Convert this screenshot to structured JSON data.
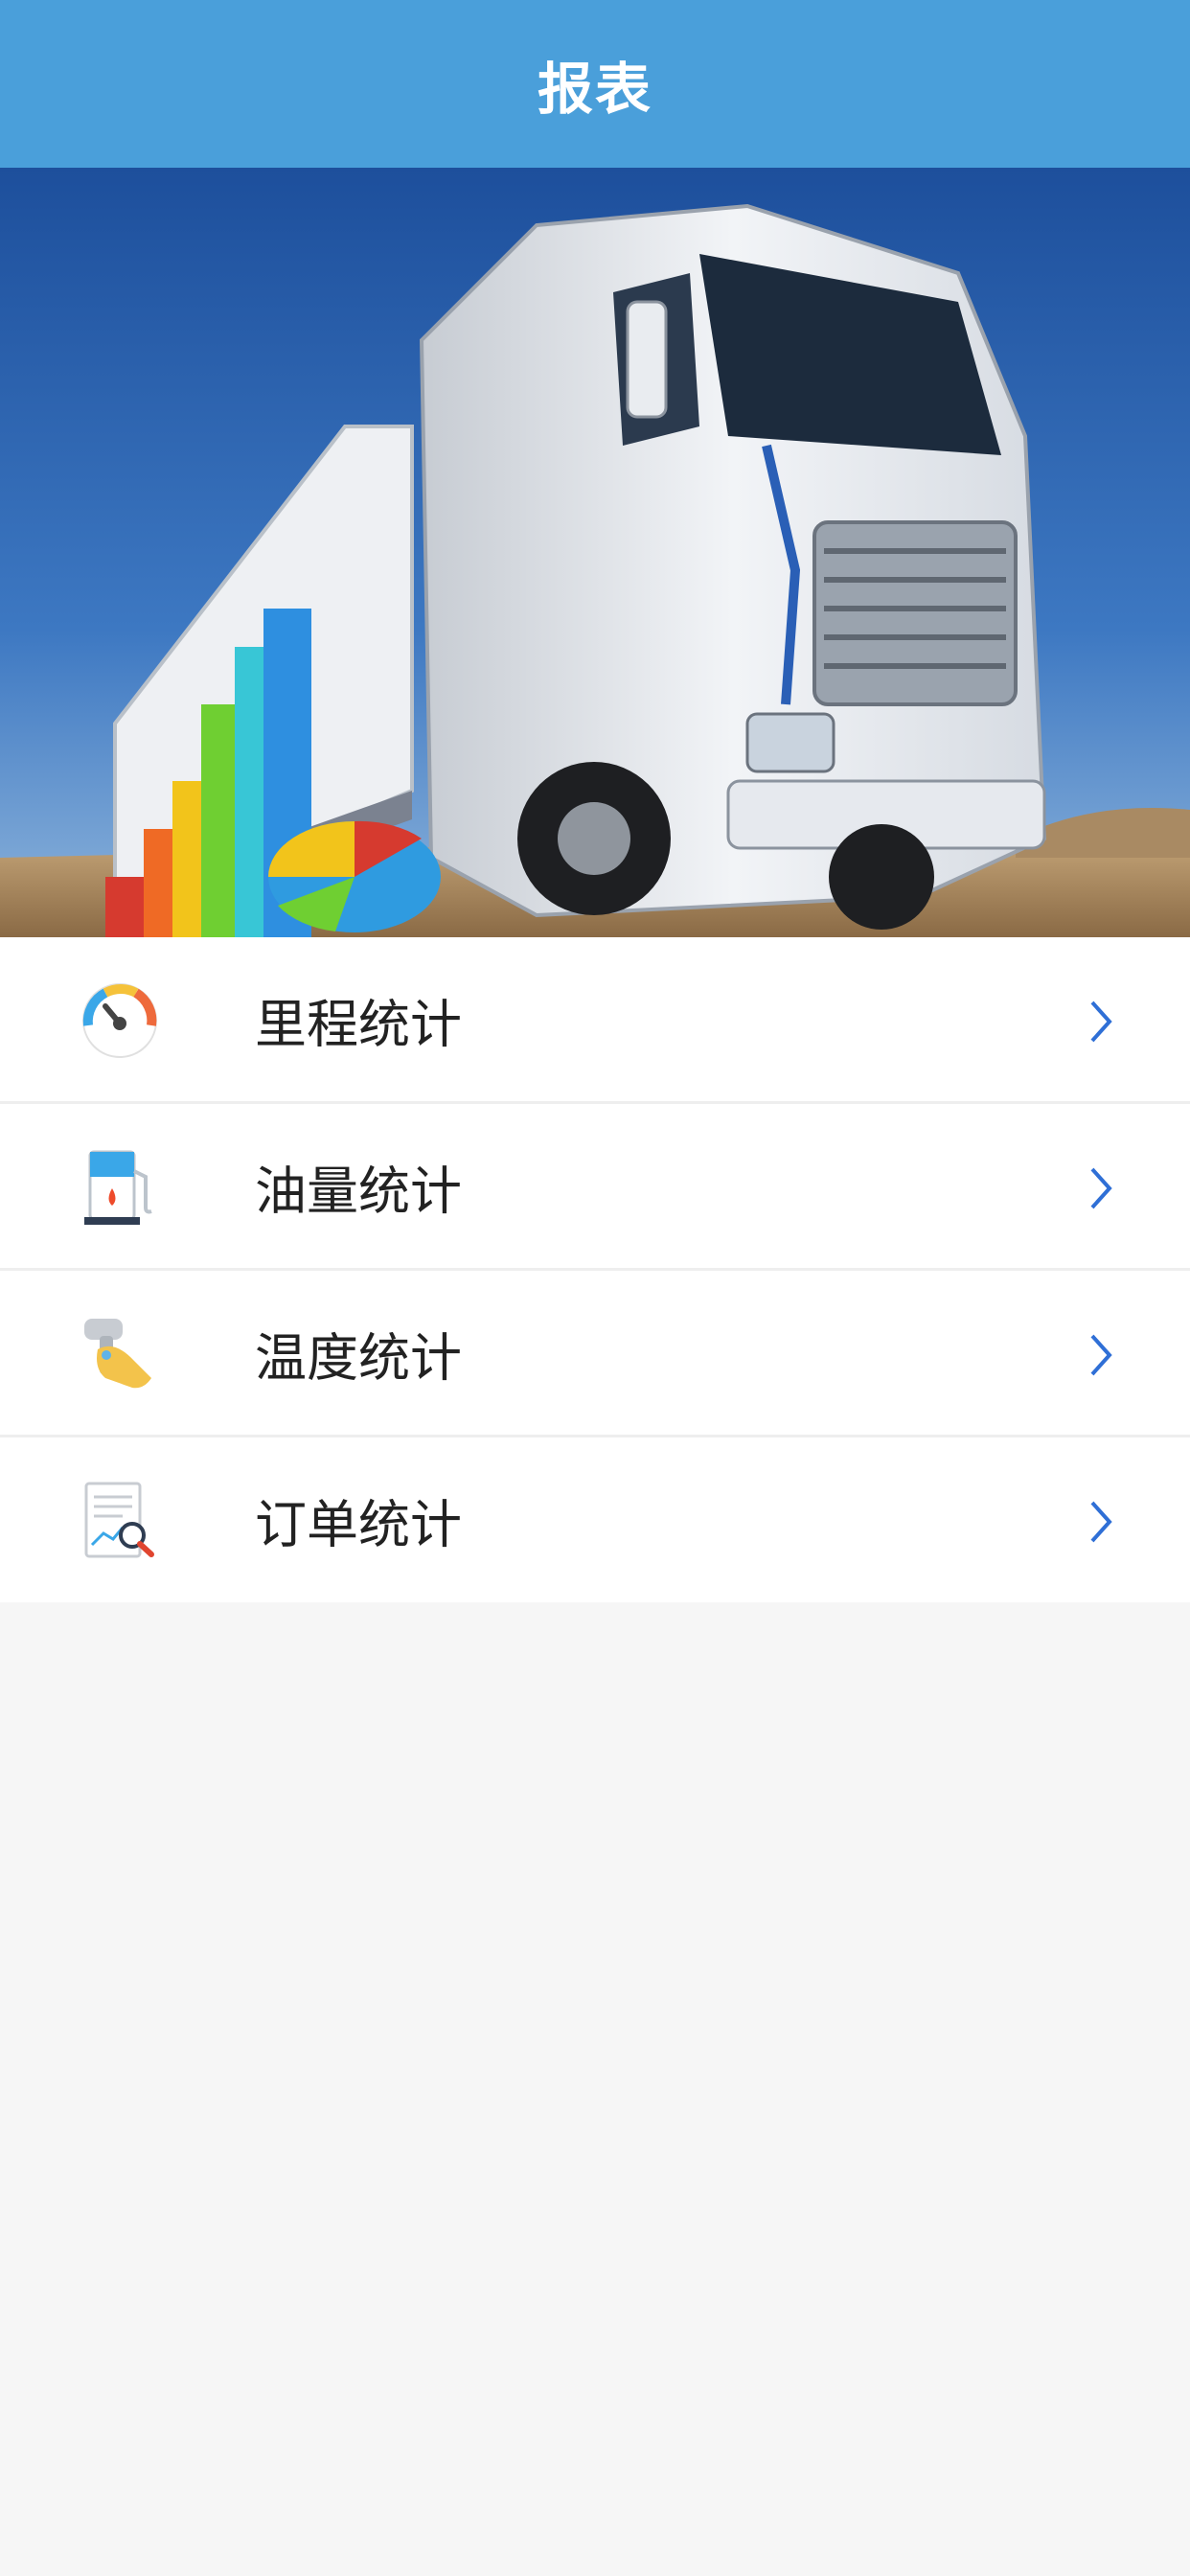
{
  "header": {
    "title": "报表"
  },
  "banner": {
    "image": "truck-with-charts-illustration"
  },
  "menu": {
    "items": [
      {
        "label": "里程统计",
        "icon": "speedometer-icon"
      },
      {
        "label": "油量统计",
        "icon": "fuel-pump-icon"
      },
      {
        "label": "温度统计",
        "icon": "thermometer-gun-icon"
      },
      {
        "label": "订单统计",
        "icon": "order-report-icon"
      }
    ],
    "chevron_color": "#2f6fd6"
  },
  "colors": {
    "navbar": "#4a9fda",
    "background": "#f6f6f6"
  }
}
